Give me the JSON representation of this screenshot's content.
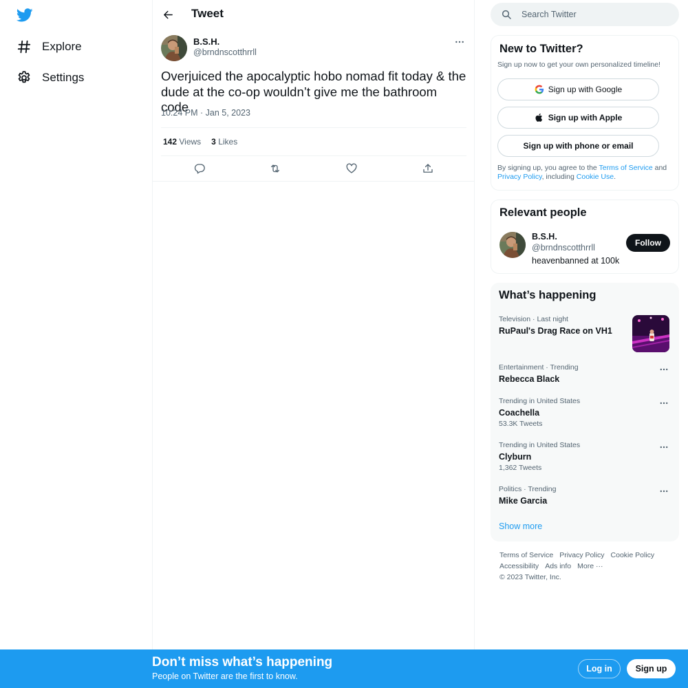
{
  "brand": {
    "accent": "#1d9bf0",
    "text_dark": "#0f1419",
    "text_muted": "#536471"
  },
  "leftnav": {
    "logo_icon": "twitter-bird-icon",
    "items": [
      {
        "label": "Explore",
        "icon": "hashtag-icon"
      },
      {
        "label": "Settings",
        "icon": "gear-icon"
      }
    ]
  },
  "header": {
    "title": "Tweet",
    "back_icon": "back-arrow-icon"
  },
  "tweet": {
    "author_name": "B.S.H.",
    "author_handle": "@brndnscotthrrll",
    "text": "Overjuiced the apocalyptic hobo nomad fit today & the dude at the co-op wouldn’t give me the bathroom code",
    "time": "10:24 PM · Jan 5, 2023",
    "views_count": "142",
    "views_label": "Views",
    "likes_count": "3",
    "likes_label": "Likes",
    "actions": [
      "reply-icon",
      "retweet-icon",
      "like-icon",
      "share-icon"
    ]
  },
  "search": {
    "placeholder": "Search Twitter"
  },
  "signup_card": {
    "title": "New to Twitter?",
    "subtitle": "Sign up now to get your own personalized timeline!",
    "google_label": "Sign up with Google",
    "apple_label": "Sign up with Apple",
    "phone_label": "Sign up with phone or email",
    "terms_prefix": "By signing up, you agree to the ",
    "terms_link": "Terms of Service",
    "terms_and": " and",
    "privacy_link": "Privacy Policy",
    "terms_including": ", including ",
    "cookie_link": "Cookie Use",
    "terms_end": "."
  },
  "relevant_people": {
    "title": "Relevant people",
    "name": "B.S.H.",
    "handle": "@brndnscotthrrll",
    "bio": "heavenbanned at 100k",
    "follow_label": "Follow"
  },
  "happening": {
    "title": "What’s happening",
    "trends": [
      {
        "meta": "Television · Last night",
        "name": "RuPaul's Drag Race on VH1",
        "count": ""
      },
      {
        "meta": "Entertainment · Trending",
        "name": "Rebecca Black",
        "count": ""
      },
      {
        "meta": "Trending in United States",
        "name": "Coachella",
        "count": "53.3K Tweets"
      },
      {
        "meta": "Trending in United States",
        "name": "Clyburn",
        "count": "1,362 Tweets"
      },
      {
        "meta": "Politics · Trending",
        "name": "Mike Garcia",
        "count": ""
      }
    ],
    "show_more": "Show more"
  },
  "footer": {
    "links": [
      "Terms of Service",
      "Privacy Policy",
      "Cookie Policy",
      "Accessibility",
      "Ads info",
      "More ···"
    ],
    "copyright": "© 2023 Twitter, Inc."
  },
  "banner": {
    "title": "Don’t miss what’s happening",
    "subtitle": "People on Twitter are the first to know.",
    "login_label": "Log in",
    "signup_label": "Sign up"
  }
}
